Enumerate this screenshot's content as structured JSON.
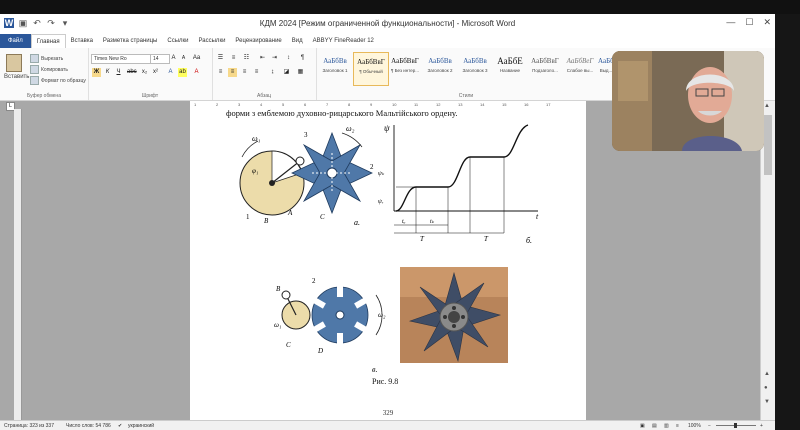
{
  "window": {
    "title": "КДМ 2024 [Режим ограниченной функциональности] - Microsoft Word",
    "logo": "W"
  },
  "tabs": [
    "Файл",
    "Главная",
    "Вставка",
    "Разметка страницы",
    "Ссылки",
    "Рассылки",
    "Рецензирование",
    "Вид",
    "ABBYY FineReader 12"
  ],
  "clipboard": {
    "paste": "Вставить",
    "cut": "Вырезать",
    "copy": "Копировать",
    "format": "Формат по образцу",
    "label": "Буфер обмена"
  },
  "font": {
    "name": "Times New Ro",
    "size": "14",
    "label": "Шрифт"
  },
  "paragraph": {
    "label": "Абзац"
  },
  "styles": {
    "label": "Стили",
    "items": [
      {
        "preview": "АаБбВв",
        "name": "Заголовок 1"
      },
      {
        "preview": "АаБбВвГ",
        "name": "¶ Обычный"
      },
      {
        "preview": "АаБбВвГ",
        "name": "¶ Без интер..."
      },
      {
        "preview": "АаБбВв",
        "name": "Заголовок 2"
      },
      {
        "preview": "АаБбВв",
        "name": "Заголовок 3"
      },
      {
        "preview": "АаБбЕ",
        "name": "Название"
      },
      {
        "preview": "АаБбВвГ",
        "name": "Подзаголо..."
      },
      {
        "preview": "АаБбВеГ",
        "name": "Слабое вы..."
      },
      {
        "preview": "АаБбВв",
        "name": "Выд..."
      }
    ]
  },
  "ruler": {
    "marks": [
      "1",
      "2",
      "3",
      "4",
      "5",
      "6",
      "7",
      "8",
      "9",
      "10",
      "11",
      "12",
      "13",
      "14",
      "15",
      "16",
      "17"
    ]
  },
  "document": {
    "text_line": "форми з емблемою духовно-рицарського Мальтійського ордену.",
    "fig_a_label": "а.",
    "fig_b_label": "б.",
    "fig_v_label": "в.",
    "caption": "Рис. 9.8",
    "page_number": "329",
    "graph": {
      "psi": "ψ",
      "t": "t",
      "T": "T",
      "to": "tₒ",
      "tk": "tₖ",
      "psi_v": "ψᵥ",
      "psi_k": "ψₖ"
    },
    "mech_labels": {
      "omega1": "ω₁",
      "omega2": "ω₂",
      "A": "A",
      "B": "B",
      "C": "C",
      "phi": "φ₁",
      "n1": "1",
      "n2": "2",
      "n3": "3",
      "D": "D"
    }
  },
  "status": {
    "page": "Страница: 323 из 337",
    "words": "Число слов: 54 786",
    "lang": "украинский",
    "zoom": "100%"
  },
  "colors": {
    "accent": "#2b579a",
    "cross": "#4f78a8",
    "disk": "#ecdcaa"
  }
}
